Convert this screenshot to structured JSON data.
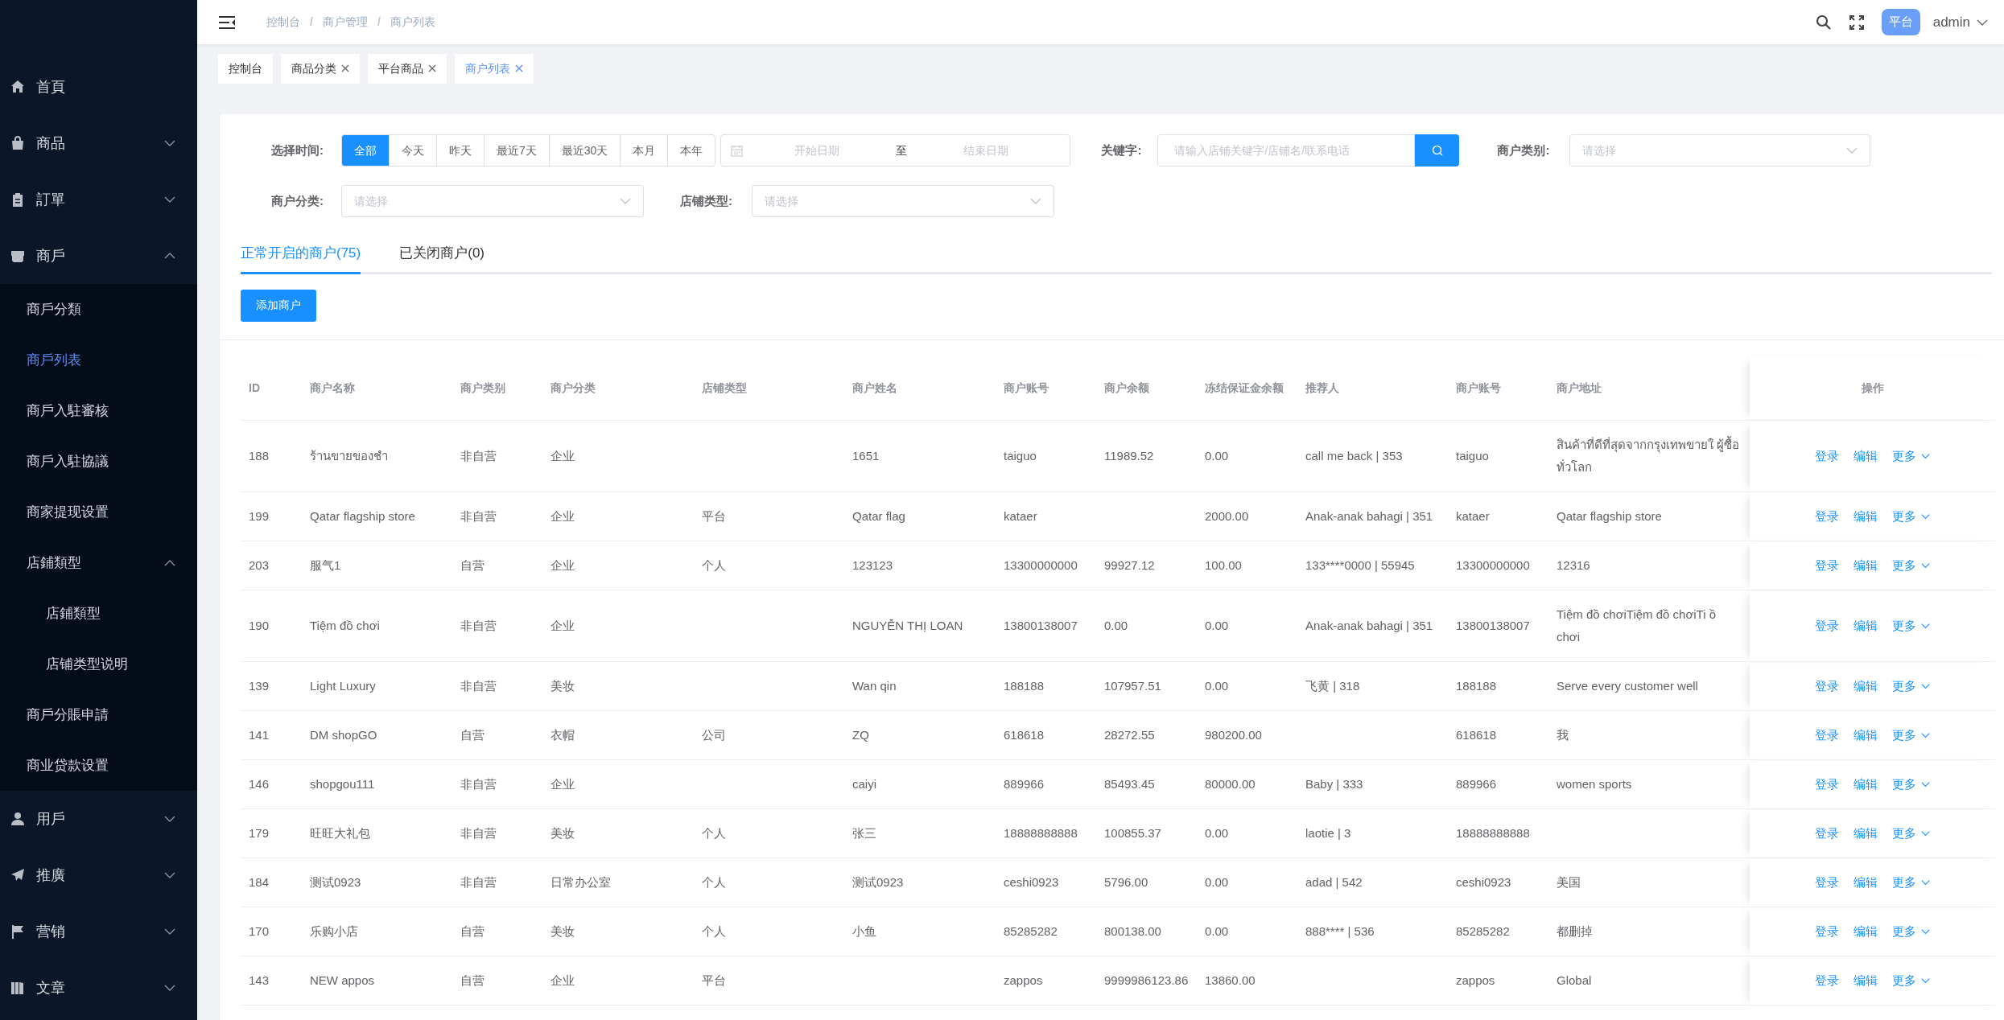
{
  "sidebar": {
    "items": [
      {
        "label": "首頁",
        "kind": "link",
        "selected": false
      },
      {
        "label": "商品",
        "kind": "group",
        "expanded": false
      },
      {
        "label": "訂單",
        "kind": "group",
        "expanded": false
      },
      {
        "label": "商戶",
        "kind": "group",
        "expanded": true,
        "children": [
          {
            "label": "商戶分類",
            "kind": "link",
            "selected": false
          },
          {
            "label": "商戶列表",
            "kind": "link",
            "selected": true
          },
          {
            "label": "商戶入駐審核",
            "kind": "link",
            "selected": false
          },
          {
            "label": "商戶入駐協議",
            "kind": "link",
            "selected": false
          },
          {
            "label": "商家提现设置",
            "kind": "link",
            "selected": false
          },
          {
            "label": "店鋪類型",
            "kind": "group",
            "expanded": true,
            "children": [
              {
                "label": "店鋪類型",
                "kind": "link",
                "selected": false
              },
              {
                "label": "店铺类型说明",
                "kind": "link",
                "selected": false
              }
            ]
          },
          {
            "label": "商戶分賬申請",
            "kind": "link",
            "selected": false
          },
          {
            "label": "商业贷款设置",
            "kind": "link",
            "selected": false
          }
        ]
      },
      {
        "label": "用戶",
        "kind": "group",
        "expanded": false
      },
      {
        "label": "推廣",
        "kind": "group",
        "expanded": false
      },
      {
        "label": "营销",
        "kind": "group",
        "expanded": false
      },
      {
        "label": "文章",
        "kind": "group",
        "expanded": false
      }
    ]
  },
  "header": {
    "breadcrumb": [
      "控制台",
      "商户管理",
      "商户列表"
    ],
    "separator": "/",
    "badge": "平台",
    "user": "admin"
  },
  "tags": [
    {
      "label": "控制台",
      "closable": false,
      "selected": false
    },
    {
      "label": "商品分类",
      "closable": true,
      "selected": false
    },
    {
      "label": "平台商品",
      "closable": true,
      "selected": false
    },
    {
      "label": "商户列表",
      "closable": true,
      "selected": true
    }
  ],
  "filters": {
    "time": {
      "label": "选择时间:",
      "options": [
        {
          "label": "全部",
          "selected": true
        },
        {
          "label": "今天",
          "selected": false
        },
        {
          "label": "昨天",
          "selected": false
        },
        {
          "label": "最近7天",
          "selected": false
        },
        {
          "label": "最近30天",
          "selected": false
        },
        {
          "label": "本月",
          "selected": false
        },
        {
          "label": "本年",
          "selected": false
        }
      ],
      "start_placeholder": "开始日期",
      "range_separator": "至",
      "end_placeholder": "结束日期"
    },
    "keyword": {
      "label": "关键字:",
      "placeholder": "请输入店铺关键字/店铺名/联系电话"
    },
    "merchant_type": {
      "label": "商户类别:",
      "placeholder": "请选择"
    },
    "merchant_category": {
      "label": "商户分类:",
      "placeholder": "请选择"
    },
    "store_type": {
      "label": "店铺类型:",
      "placeholder": "请选择"
    }
  },
  "tabs": [
    {
      "label": "正常开启的商户(75)",
      "selected": true
    },
    {
      "label": "已关闭商户(0)",
      "selected": false
    }
  ],
  "add_button": "添加商户",
  "table": {
    "columns": [
      "ID",
      "商户名称",
      "商户类别",
      "商户分类",
      "店铺类型",
      "商户姓名",
      "商户账号",
      "商户余额",
      "冻结保证金余额",
      "推荐人",
      "商户账号",
      "商户地址",
      "操作"
    ],
    "rows": [
      {
        "cells": [
          "188",
          "ร้านขายของชำ",
          "非自营",
          "企业",
          null,
          "1651",
          "taiguo",
          "11989.52",
          "0.00",
          "call me back | 353",
          "taiguo",
          "สินค้าที่ดีที่สุดจากกรุงเทพขายใ ผู้ซื้อทั่วโลก"
        ],
        "actions": [
          "登录",
          "编辑",
          "更多"
        ]
      },
      {
        "cells": [
          "199",
          "Qatar flagship store",
          "非自营",
          "企业",
          "平台",
          "Qatar flag",
          "kataer",
          null,
          "2000.00",
          "Anak-anak bahagi | 351",
          "kataer",
          "Qatar flagship store"
        ],
        "actions": [
          "登录",
          "编辑",
          "更多"
        ]
      },
      {
        "cells": [
          "203",
          "服气1",
          "自营",
          "企业",
          "个人",
          "123123",
          "13300000000",
          "99927.12",
          "100.00",
          "133****0000 | 55945",
          "13300000000",
          "12316"
        ],
        "actions": [
          "登录",
          "编辑",
          "更多"
        ]
      },
      {
        "cells": [
          "190",
          "Tiệm đồ chơi",
          "非自营",
          "企业",
          null,
          "NGUYỄN THỊ LOAN",
          "13800138007",
          "0.00",
          "0.00",
          "Anak-anak bahagi | 351",
          "13800138007",
          "Tiệm đồ chơiTiệm đồ chơiTi ồ chơi"
        ],
        "actions": [
          "登录",
          "编辑",
          "更多"
        ]
      },
      {
        "cells": [
          "139",
          "Light Luxury",
          "非自营",
          "美妆",
          null,
          "Wan qin",
          "188188",
          "107957.51",
          "0.00",
          "飞黄 | 318",
          "188188",
          "Serve every customer well"
        ],
        "actions": [
          "登录",
          "编辑",
          "更多"
        ]
      },
      {
        "cells": [
          "141",
          "DM shopGO",
          "自营",
          "衣帽",
          "公司",
          "ZQ",
          "618618",
          "28272.55",
          "980200.00",
          null,
          "618618",
          "我"
        ],
        "actions": [
          "登录",
          "编辑",
          "更多"
        ]
      },
      {
        "cells": [
          "146",
          "shopgou111",
          "非自营",
          "企业",
          null,
          "caiyi",
          "889966",
          "85493.45",
          "80000.00",
          "Baby | 333",
          "889966",
          "women sports"
        ],
        "actions": [
          "登录",
          "编辑",
          "更多"
        ]
      },
      {
        "cells": [
          "179",
          "旺旺大礼包",
          "非自营",
          "美妆",
          "个人",
          "张三",
          "18888888888",
          "100855.37",
          "0.00",
          "laotie | 3",
          "18888888888",
          null
        ],
        "actions": [
          "登录",
          "编辑",
          "更多"
        ]
      },
      {
        "cells": [
          "184",
          "测试0923",
          "非自营",
          "日常办公室",
          "个人",
          "测试0923",
          "ceshi0923",
          "5796.00",
          "0.00",
          "adad | 542",
          "ceshi0923",
          "美国"
        ],
        "actions": [
          "登录",
          "编辑",
          "更多"
        ]
      },
      {
        "cells": [
          "170",
          "乐购小店",
          "自营",
          "美妆",
          "个人",
          "小鱼",
          "85285282",
          "800138.00",
          "0.00",
          "888**** | 536",
          "85285282",
          "都删掉"
        ],
        "actions": [
          "登录",
          "编辑",
          "更多"
        ]
      },
      {
        "cells": [
          "143",
          "NEW appos",
          "自营",
          "企业",
          "平台",
          null,
          "zappos",
          "9999986123.86",
          "13860.00",
          null,
          "zappos",
          "Global"
        ],
        "actions": [
          "登录",
          "编辑",
          "更多"
        ]
      }
    ]
  }
}
